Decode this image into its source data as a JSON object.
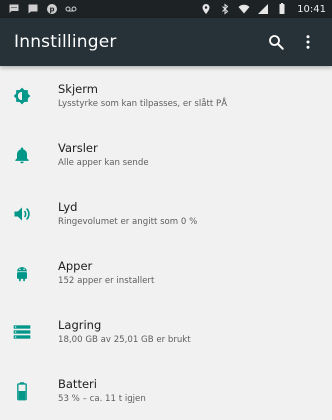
{
  "status_bar": {
    "time": "10:41",
    "left_icons": [
      "sms-icon",
      "chat-icon",
      "pinterest-icon",
      "voicemail-icon"
    ],
    "right_icons": [
      "location-icon",
      "bluetooth-icon",
      "wifi-icon",
      "signal-icon",
      "battery-icon"
    ]
  },
  "app_bar": {
    "title": "Innstillinger",
    "search_icon": "search-icon",
    "menu_icon": "more-vert-icon"
  },
  "colors": {
    "accent": "#009688",
    "app_bar_bg": "#263238",
    "status_bar_bg": "#1d2224",
    "list_bg": "#f1f1f1"
  },
  "settings": [
    {
      "title": "Skjerm",
      "subtitle": "Lysstyrke som kan tilpasses, er slått PÅ",
      "icon": "brightness-icon"
    },
    {
      "title": "Varsler",
      "subtitle": "Alle apper kan sende",
      "icon": "bell-icon"
    },
    {
      "title": "Lyd",
      "subtitle": "Ringevolumet er angitt som 0 %",
      "icon": "volume-icon"
    },
    {
      "title": "Apper",
      "subtitle": "152 apper er installert",
      "icon": "android-icon"
    },
    {
      "title": "Lagring",
      "subtitle": "18,00 GB av 25,01 GB er brukt",
      "icon": "storage-icon"
    },
    {
      "title": "Batteri",
      "subtitle": "53 % – ca. 11 t igjen",
      "icon": "battery-icon"
    }
  ]
}
